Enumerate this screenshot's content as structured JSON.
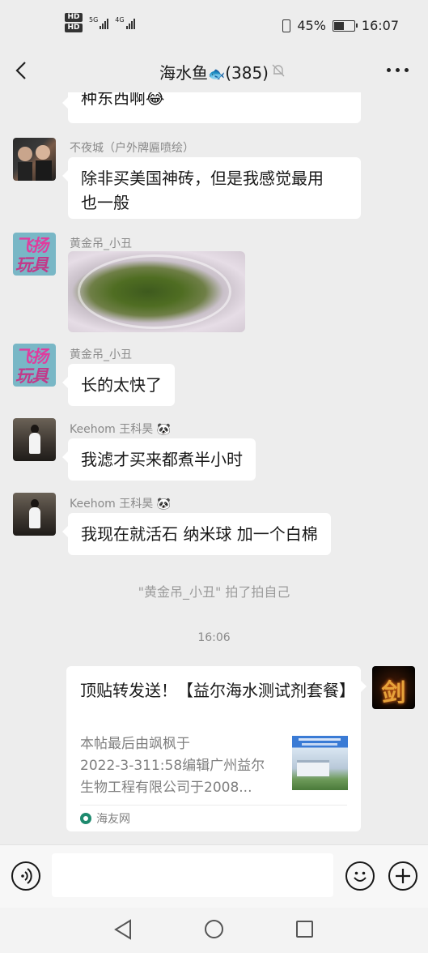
{
  "status_bar": {
    "hd1": "HD",
    "hd2": "HD",
    "net1": "5G",
    "net2": "4G",
    "battery": "45%",
    "time": "16:07",
    "battery_level": 0.45
  },
  "header": {
    "title": "海水鱼",
    "fish_emoji": "🐟",
    "count": "(385)"
  },
  "messages": [
    {
      "type": "text",
      "text": "种东西啊😂"
    },
    {
      "type": "text",
      "sender": "不夜城（户外牌匾喷绘）",
      "text_line1": "除非买美国神砖，但是我感觉最用",
      "text_line2": "也一般"
    },
    {
      "type": "image",
      "sender": "黄金吊_小丑"
    },
    {
      "type": "text",
      "sender": "黄金吊_小丑",
      "text": "长的太快了"
    },
    {
      "type": "text",
      "sender": "Keehom 王科昊 🐼",
      "text": "我滤才买来都煮半小时"
    },
    {
      "type": "text",
      "sender": "Keehom 王科昊 🐼",
      "text": "我现在就活石 纳米球 加一个白棉"
    }
  ],
  "system_notice": "\"黄金吊_小丑\" 拍了拍自己",
  "timestamp": "16:06",
  "card": {
    "title": "顶贴转发送！【益尔海水测试剂套餐】",
    "desc_line1": "本帖最后由飒枫于",
    "desc_line2": "2022-3-311:58编辑广州益尔",
    "desc_line3": "生物工程有限公司于2008...",
    "source": "海友网"
  },
  "avatar_toy": {
    "line1": "飞扬",
    "line2": "玩具"
  },
  "avatar_sword": {
    "glyph": "剑"
  },
  "input": {
    "placeholder": ""
  }
}
